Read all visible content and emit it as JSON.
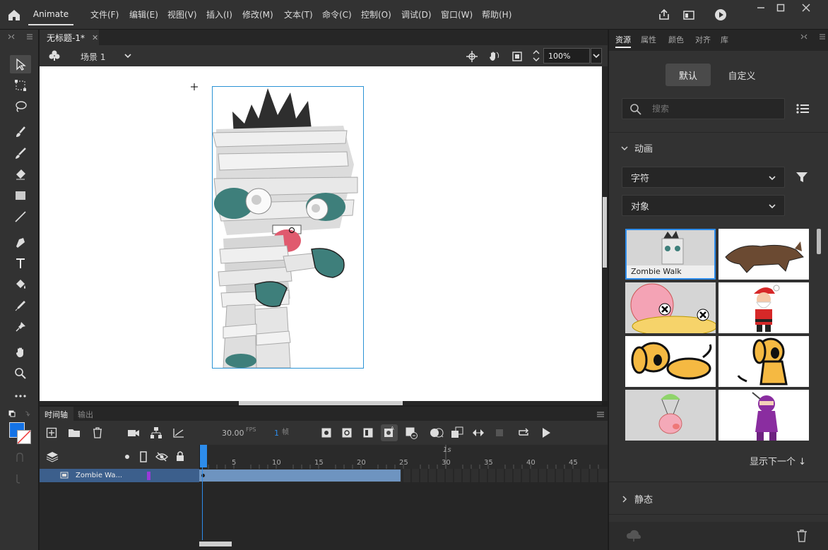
{
  "app": {
    "name": "Animate",
    "menus": [
      "文件(F)",
      "编辑(E)",
      "视图(V)",
      "插入(I)",
      "修改(M)",
      "文本(T)",
      "命令(C)",
      "控制(O)",
      "调试(D)",
      "窗口(W)",
      "帮助(H)"
    ]
  },
  "document": {
    "tab_title": "无标题-1*",
    "scene": "场景 1",
    "zoom": "100%"
  },
  "timeline": {
    "tabs": [
      "时间轴",
      "输出"
    ],
    "fps": "30.00",
    "fps_unit": "FPS",
    "frame": "1",
    "frame_unit": "帧",
    "second_marker": "1s",
    "ticks": [
      "5",
      "10",
      "15",
      "20",
      "25",
      "30",
      "35",
      "40",
      "45"
    ],
    "layer_name": "Zombie Wa..."
  },
  "assets_panel": {
    "tabs": [
      "资源",
      "属性",
      "颜色",
      "对齐",
      "库"
    ],
    "buttons": {
      "default": "默认",
      "custom": "自定义"
    },
    "search_placeholder": "搜索",
    "section_animation": "动画",
    "filter_type": "字符",
    "filter_kind": "对象",
    "selected_item_label": "Zombie Walk",
    "show_next": "显示下一个 ↓",
    "section_static": "静态"
  },
  "colors": {
    "accent": "#2d8ceb",
    "stroke_color": "#1473e6",
    "layer_bar": "#6e94c0"
  }
}
